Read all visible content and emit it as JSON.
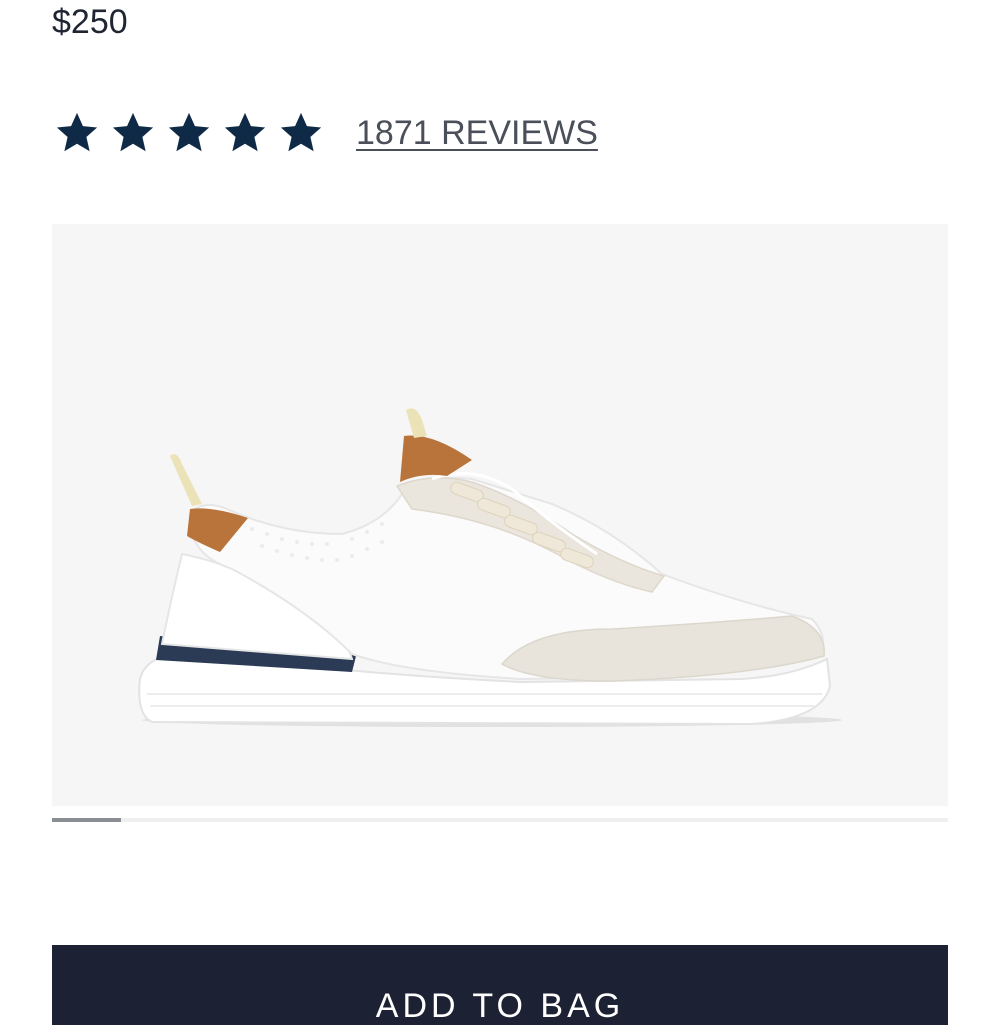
{
  "product": {
    "price": "$250",
    "rating": {
      "stars_filled": 5,
      "stars_total": 5,
      "star_color": "#0f2a47"
    },
    "reviews_link": "1871 REVIEWS"
  },
  "gallery": {
    "image_alt": "",
    "slide_index": 1,
    "slide_progress": 0.077,
    "background": "#f6f6f6"
  },
  "cta": {
    "add_to_bag_label": "ADD TO BAG",
    "color": "#1c2233"
  }
}
